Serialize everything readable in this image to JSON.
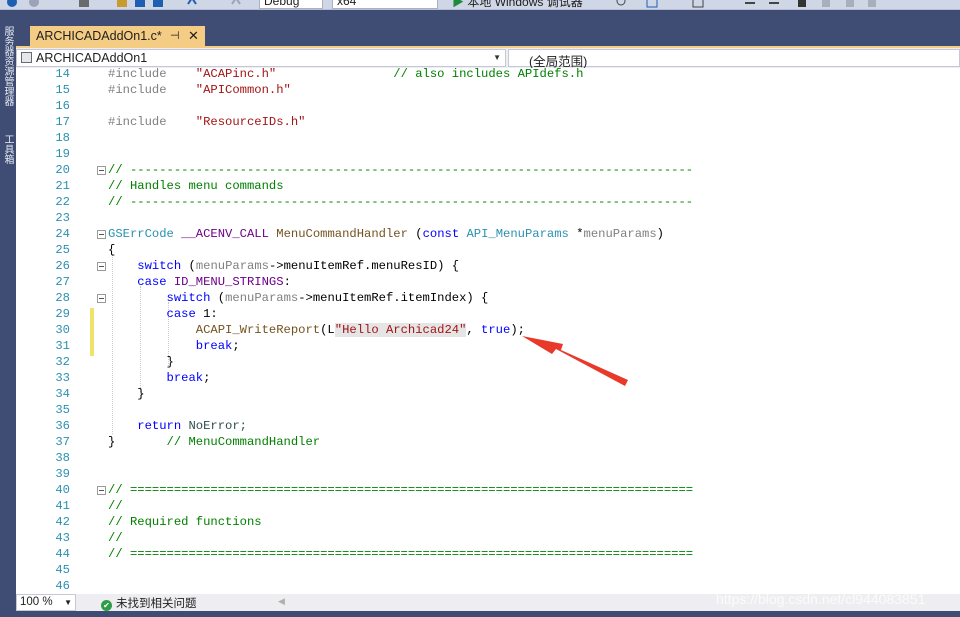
{
  "toolbar": {
    "config": "Debug",
    "platform": "x64",
    "run_label": "本地 Windows 调试器"
  },
  "left_strip": {
    "tab1": "服务器资源管理器",
    "tab2": "工具箱"
  },
  "tab": {
    "title": "ARCHICADAddOn1.c*",
    "pin": "⊣",
    "close": "✕"
  },
  "nav": {
    "project": "ARCHICADAddOn1",
    "scope": "(全局范围)"
  },
  "editor": {
    "lines": [
      {
        "n": "14"
      },
      {
        "n": "15"
      },
      {
        "n": "16"
      },
      {
        "n": "17"
      },
      {
        "n": "18"
      },
      {
        "n": "19"
      },
      {
        "n": "20"
      },
      {
        "n": "21"
      },
      {
        "n": "22"
      },
      {
        "n": "23"
      },
      {
        "n": "24"
      },
      {
        "n": "25"
      },
      {
        "n": "26"
      },
      {
        "n": "27"
      },
      {
        "n": "28"
      },
      {
        "n": "29"
      },
      {
        "n": "30"
      },
      {
        "n": "31"
      },
      {
        "n": "32"
      },
      {
        "n": "33"
      },
      {
        "n": "34"
      },
      {
        "n": "35"
      },
      {
        "n": "36"
      },
      {
        "n": "37"
      },
      {
        "n": "38"
      },
      {
        "n": "39"
      },
      {
        "n": "40"
      },
      {
        "n": "41"
      },
      {
        "n": "42"
      },
      {
        "n": "43"
      },
      {
        "n": "44"
      },
      {
        "n": "45"
      },
      {
        "n": "46"
      }
    ],
    "t": {
      "inc": "#include",
      "acapinc": "\"ACAPinc.h\"",
      "acapinc_cm": "// also includes APIdefs.h",
      "apicommon": "\"APICommon.h\"",
      "resourceids": "\"ResourceIDs.h\"",
      "cm_dash": "// -----------------------------------------------------------------------------",
      "cm_handles": "// Handles menu commands",
      "gserr": "GSErrCode",
      "acenv": "__ACENV_CALL",
      "handler": "MenuCommandHandler",
      "open_paren": "(",
      "const": "const",
      "menuparams_t": "API_MenuParams",
      "ptr": "*",
      "menuparams": "menuParams",
      "close_paren": ")",
      "brace_open": "{",
      "brace_close": "}",
      "switch": "switch",
      "arrow1": "->menuItemRef.menuResID) {",
      "case": "case",
      "id_menu": "ID_MENU_STRINGS",
      "colon": ":",
      "arrow2": "->menuItemRef.itemIndex) {",
      "one": "1:",
      "writereport": "ACAPI_WriteReport",
      "l_prefix": "(L",
      "hello": "\"Hello Archicad24\"",
      "comma": ", ",
      "true": "true",
      "end_call": ");",
      "break": "break",
      "semi": ";",
      "return": "return",
      "noerror": "NoError;",
      "cm_handler": "// MenuCommandHandler",
      "cm_eq": "// =============================================================================",
      "cm_slash": "//",
      "cm_required": "// Required functions"
    }
  },
  "status": {
    "zoom": "100 %",
    "issues": "未找到相关问题"
  },
  "watermark": "https://blog.csdn.net/cl944083851",
  "colors": {
    "accent": "#f5cc84",
    "arrow": "#e8392b",
    "frame": "#3f4d75"
  }
}
